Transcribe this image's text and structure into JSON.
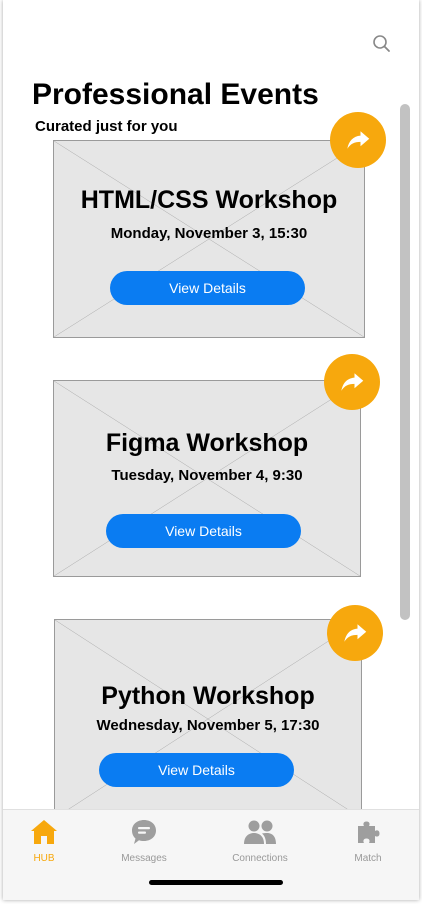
{
  "header": {
    "title": "Professional Events",
    "subtitle": "Curated just for you"
  },
  "events": [
    {
      "title": "HTML/CSS Workshop",
      "date": "Monday, November 3, 15:30",
      "button": "View Details"
    },
    {
      "title": "Figma Workshop",
      "date": "Tuesday, November 4, 9:30",
      "button": "View Details"
    },
    {
      "title": "Python Workshop",
      "date": "Wednesday, November 5, 17:30",
      "button": "View Details"
    }
  ],
  "tabs": [
    {
      "label": "HUB",
      "icon": "home-icon",
      "active": true
    },
    {
      "label": "Messages",
      "icon": "message-icon",
      "active": false
    },
    {
      "label": "Connections",
      "icon": "people-icon",
      "active": false
    },
    {
      "label": "Match",
      "icon": "puzzle-icon",
      "active": false
    }
  ],
  "colors": {
    "accent": "#f7a80d",
    "button": "#0a7cf2",
    "placeholder": "#e6e6e6"
  }
}
